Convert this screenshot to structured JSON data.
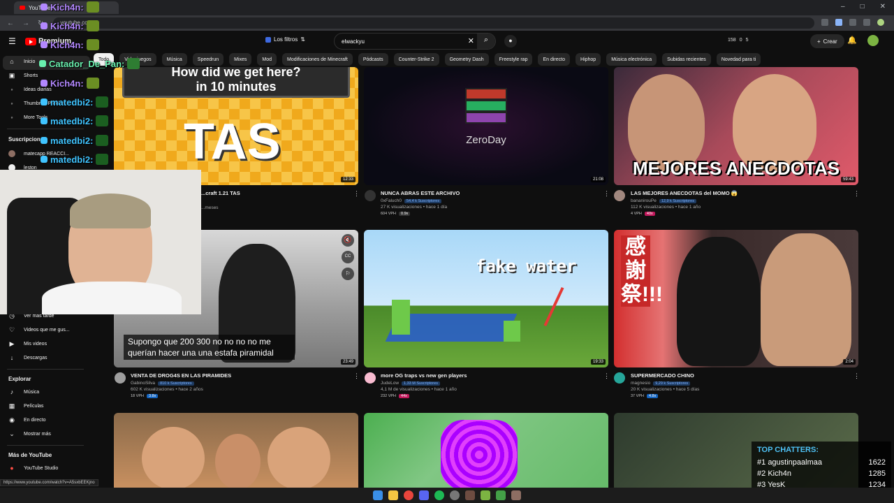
{
  "browser": {
    "tab_title": "YouTube",
    "url": "youtube.com",
    "status_url": "https://www.youtube.com/watch?v=A5sxbEEKjno"
  },
  "header": {
    "brand": "Premium",
    "filters_label": "Los filtros",
    "search_value": "elwackyu",
    "stats": [
      "158",
      "0",
      "5"
    ],
    "create_label": "Crear"
  },
  "chips": [
    "Todo",
    "Videojuegos",
    "Música",
    "Speedrun",
    "Mixes",
    "Mod",
    "Modificaciones de Minecraft",
    "Pódcasts",
    "Counter-Strike 2",
    "Geometry Dash",
    "Freestyle rap",
    "En directo",
    "Hiphop",
    "Música electrónica",
    "Subidas recientes",
    "Novedad para ti"
  ],
  "sidebar": {
    "top_items": [
      {
        "label": "Inicio",
        "icon": "home-icon"
      },
      {
        "label": "Shorts",
        "icon": "shorts-icon"
      },
      {
        "label": "Ideas diarias",
        "icon": "lightbulb-icon"
      },
      {
        "label": "Thumbnail Preview",
        "icon": "image-icon"
      },
      {
        "label": "More Tools",
        "icon": "tools-icon"
      }
    ],
    "subs_heading": "Suscripciones",
    "subs": [
      {
        "label": "matecapp REACCI..."
      },
      {
        "label": "leston"
      }
    ],
    "you_items": [
      {
        "label": "Ver más tarde",
        "icon": "clock-icon"
      },
      {
        "label": "Videos que me gus...",
        "icon": "thumbs-up-icon"
      },
      {
        "label": "Mis videos",
        "icon": "play-square-icon"
      },
      {
        "label": "Descargas",
        "icon": "download-icon"
      }
    ],
    "explore_heading": "Explorar",
    "explore_items": [
      {
        "label": "Música",
        "icon": "music-icon"
      },
      {
        "label": "Películas",
        "icon": "film-icon"
      },
      {
        "label": "En directo",
        "icon": "live-icon"
      },
      {
        "label": "Mostrar más",
        "icon": "chevron-down-icon"
      }
    ],
    "more_heading": "Más de YouTube",
    "more_items": [
      {
        "label": "YouTube Studio",
        "icon": "studio-icon"
      }
    ]
  },
  "videos": [
    {
      "title": "...craft 1.21 TAS",
      "channel": "",
      "stats": "...meses",
      "duration": "12:33",
      "thumb_text": "TAS",
      "thumb_top": "How did we get here?",
      "thumb_sub": "in 10 minutes"
    },
    {
      "title": "NUNCA ABRAS ESTE ARCHIVO",
      "channel": "0xFaluch0",
      "subs": "54,4 k Suscriptores",
      "stats": "27 K visualizaciones • hace 1 día",
      "vph": "604 VPH",
      "mult": "0.9x",
      "duration": "21:08",
      "thumb_text": "ZeroDay"
    },
    {
      "title": "LAS MEJORES ANECDOTAS del MOMO 😱",
      "channel": "bananirouPe",
      "subs": "12,9 k Suscriptores",
      "stats": "112 K visualizaciones • hace 1 año",
      "vph": "4 VPH",
      "mult": "40x",
      "duration": "59:43",
      "thumb_text": "MEJORES ANECDOTAS"
    },
    {
      "title": "VENTA DE DROG4S EN LAS PIRAMIDES",
      "channel": "GabinoSilva",
      "subs": "810 k Suscriptores",
      "stats": "602 K visualizaciones • hace 2 años",
      "vph": "18 VPH",
      "mult": "3.8x",
      "duration": "23:49",
      "caption": "Supongo que 200 300 no no no no me querían hacer una una estafa piramidal"
    },
    {
      "title": "more OG traps vs new gen players",
      "channel": "JudeLow",
      "subs": "1,33 M Suscriptores",
      "stats": "4,1 M de visualizaciones • hace 1 año",
      "vph": "232 VPH",
      "mult": "44x",
      "duration": "19:33",
      "thumb_text": "fake water"
    },
    {
      "title": "SUPERMERCADO CHINO",
      "channel": "magnesio",
      "subs": "9,29 k Suscriptores",
      "stats": "20 K visualizaciones • hace 5 días",
      "vph": "37 VPH",
      "mult": "4.8x",
      "duration": "2:04",
      "thumb_text": "感謝祭!!!"
    }
  ],
  "chat": [
    {
      "user": "Kich4n:",
      "color": "#b388ff"
    },
    {
      "user": "Kich4n:",
      "color": "#b388ff"
    },
    {
      "user": "Kich4n:",
      "color": "#b388ff"
    },
    {
      "user": "Catador_De_Pan:",
      "color": "#69f0ae"
    },
    {
      "user": "Kich4n:",
      "color": "#b388ff"
    },
    {
      "user": "matedbi2:",
      "color": "#40c4ff"
    },
    {
      "user": "matedbi2:",
      "color": "#40c4ff"
    },
    {
      "user": "matedbi2:",
      "color": "#40c4ff"
    },
    {
      "user": "matedbi2:",
      "color": "#40c4ff"
    }
  ],
  "top_chatters": {
    "title": "TOP CHATTERS:",
    "rows": [
      {
        "rank": "#1",
        "name": "agustinpaalmaa",
        "count": "1622"
      },
      {
        "rank": "#2",
        "name": "Kich4n",
        "count": "1285"
      },
      {
        "rank": "#3",
        "name": "YesK",
        "count": "1234"
      }
    ]
  },
  "colors": {
    "brand": "#ff0000",
    "bg": "#0f0f0f",
    "chip": "#272727"
  }
}
